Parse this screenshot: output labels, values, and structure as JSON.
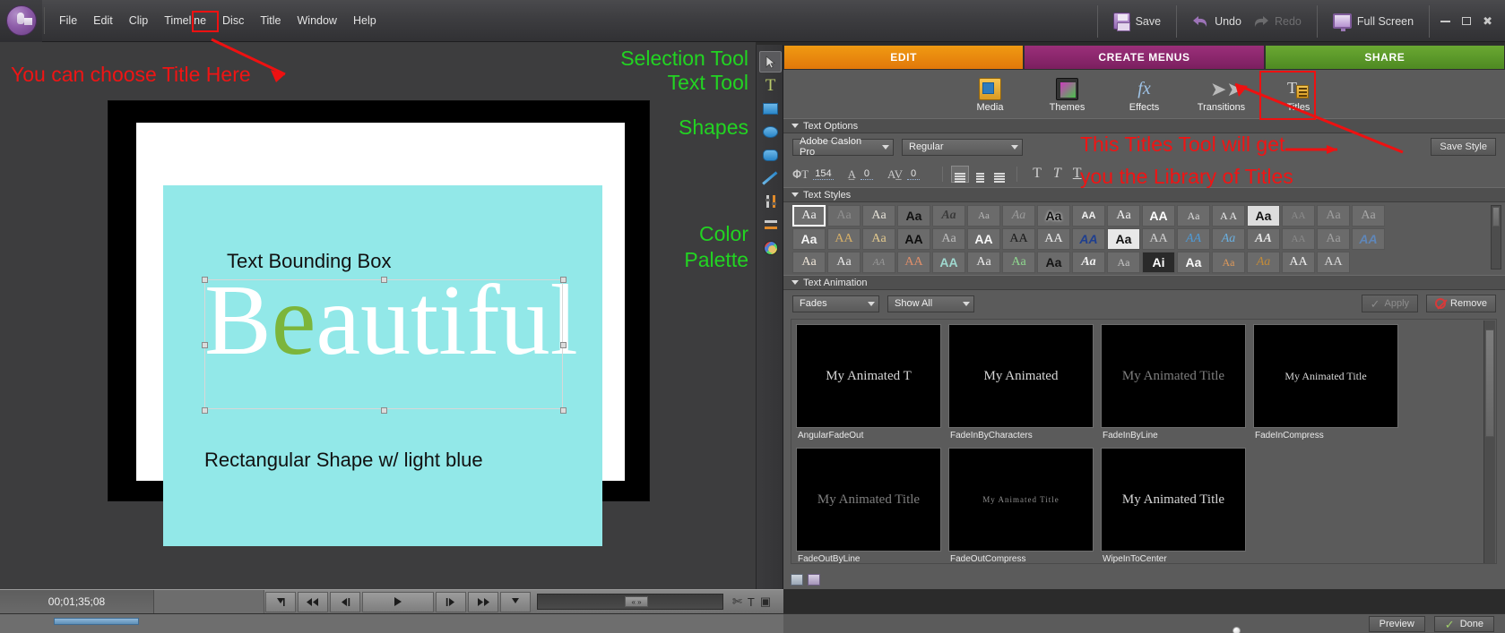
{
  "app": {
    "logo_icon": "adobe-premiere-elements-logo"
  },
  "menubar": {
    "items": [
      {
        "label": "File"
      },
      {
        "label": "Edit"
      },
      {
        "label": "Clip"
      },
      {
        "label": "Timeline"
      },
      {
        "label": "Disc"
      },
      {
        "label": "Title",
        "highlighted": true
      },
      {
        "label": "Window"
      },
      {
        "label": "Help"
      }
    ]
  },
  "topright": {
    "save_label": "Save",
    "save_icon": "floppy-disk-icon",
    "undo_label": "Undo",
    "undo_icon": "undo-arrow-icon",
    "redo_label": "Redo",
    "redo_icon": "redo-arrow-icon",
    "fullscreen_label": "Full Screen",
    "fullscreen_icon": "monitor-icon",
    "minimize_icon": "minimize-icon",
    "maximize_icon": "maximize-icon",
    "close_icon": "close-icon"
  },
  "annotations": [
    {
      "id": "title-here",
      "text": "You can choose Title Here",
      "color": "#f01414"
    },
    {
      "id": "selection-tool",
      "text": "Selection Tool",
      "color": "#22d422"
    },
    {
      "id": "text-tool",
      "text": "Text Tool",
      "color": "#22d422"
    },
    {
      "id": "shapes",
      "text": "Shapes",
      "color": "#22d422"
    },
    {
      "id": "color",
      "text": "Color",
      "color": "#22d422"
    },
    {
      "id": "palette",
      "text": "Palette",
      "color": "#22d422"
    },
    {
      "id": "titles-tool-1",
      "text": "This Titles Tool will get",
      "color": "#f01414"
    },
    {
      "id": "titles-tool-2",
      "text": "you the Library of Titles",
      "color": "#f01414"
    }
  ],
  "canvas": {
    "text_bounding_box_label": "Text Bounding Box",
    "title_text_part1": "B",
    "title_text_green": "e",
    "title_text_part2": "autiful",
    "rect_caption": "Rectangular Shape w/ light blue",
    "shape_color": "#92e8e8",
    "title_color": "#ffffff",
    "accent_letter_color": "#7cb53b"
  },
  "toolstrip": {
    "tools": [
      {
        "name": "selection-tool",
        "icon": "cursor-arrow-icon",
        "active": true
      },
      {
        "name": "text-tool",
        "icon": "text-T-icon",
        "active": false
      },
      {
        "name": "rectangle-tool",
        "icon": "rectangle-icon",
        "active": false
      },
      {
        "name": "ellipse-tool",
        "icon": "ellipse-icon",
        "active": false
      },
      {
        "name": "rounded-rect-tool",
        "icon": "rounded-rectangle-icon",
        "active": false
      },
      {
        "name": "line-tool",
        "icon": "line-icon",
        "active": false
      },
      {
        "name": "vertical-align-tool",
        "icon": "vertical-align-icon",
        "active": false
      },
      {
        "name": "horizontal-align-tool",
        "icon": "horizontal-align-icon",
        "active": false
      },
      {
        "name": "color-palette-tool",
        "icon": "palette-icon",
        "active": false
      }
    ]
  },
  "right_panel": {
    "mode_tabs": [
      {
        "label": "EDIT",
        "color": "#e9850e",
        "active": true
      },
      {
        "label": "CREATE MENUS",
        "color": "#8b2a6c",
        "active": false
      },
      {
        "label": "SHARE",
        "color": "#5c9a2a",
        "active": false
      }
    ],
    "tool_icons": [
      {
        "label": "Media",
        "icon": "media-icon",
        "highlighted": false
      },
      {
        "label": "Themes",
        "icon": "themes-icon",
        "highlighted": false
      },
      {
        "label": "Effects",
        "icon": "fx-icon",
        "highlighted": false
      },
      {
        "label": "Transitions",
        "icon": "transitions-arrow-icon",
        "highlighted": false
      },
      {
        "label": "Titles",
        "icon": "titles-icon",
        "highlighted": true
      }
    ],
    "text_options": {
      "section_title": "Text Options",
      "save_style_label": "Save Style",
      "font_family": "Adobe Caslon Pro",
      "font_style": "Regular",
      "font_size_icon": "font-size-icon",
      "font_size": "154",
      "leading_icon": "leading-icon",
      "leading": "0",
      "tracking_icon": "kerning-icon",
      "tracking": "0",
      "align_left_icon": "align-left-icon",
      "align_center_icon": "align-center-icon",
      "align_right_icon": "align-right-icon",
      "bold_label": "T",
      "italic_label": "T",
      "underline_label": "T"
    },
    "text_styles": {
      "section_title": "Text Styles",
      "swatches": [
        {
          "text": "Aa",
          "selected": true,
          "css": "font-family:'Liberation Serif',serif;color:#efefef;"
        },
        {
          "text": "Aa",
          "css": "font-family:'Liberation Serif',serif;color:#8f8f8f;"
        },
        {
          "text": "Aa",
          "css": "font-family:'Liberation Serif',serif;color:#e6e2d8;"
        },
        {
          "text": "Aa",
          "css": "font-family:'Liberation Sans',sans-serif;font-weight:bold;color:#111;"
        },
        {
          "text": "Aa",
          "css": "font-family:'Liberation Serif',serif;font-style:italic;font-weight:bold;color:#3a3a3a;"
        },
        {
          "text": "Aa",
          "css": "font-family:'Liberation Serif',serif;color:#b9b9b9;font-size:11px;"
        },
        {
          "text": "Aa",
          "css": "font-family:'Liberation Serif',serif;font-style:italic;color:#9a9a9a;"
        },
        {
          "text": "Aa",
          "css": "font-family:'Liberation Sans',sans-serif;font-weight:bold;color:#111;text-shadow:0 0 3px #fff;"
        },
        {
          "text": "AA",
          "css": "font-family:'Liberation Sans',sans-serif;font-weight:bold;font-size:11px;color:#f2f2f2;"
        },
        {
          "text": "Aa",
          "css": "font-family:'Liberation Serif',serif;color:#f4f4f4;"
        },
        {
          "text": "AA",
          "css": "font-family:'Liberation Sans',sans-serif;font-weight:bold;color:#fff;"
        },
        {
          "text": "Aa",
          "css": "font-family:'Liberation Serif',serif;color:#dcdcdc;font-size:12px;"
        },
        {
          "text": "A A",
          "css": "font-family:'Liberation Serif',serif;color:#ededed;font-size:12px;"
        },
        {
          "text": "Aa",
          "css": "font-family:'Liberation Sans',sans-serif;font-weight:bold;color:#111;background:#ddd;"
        },
        {
          "text": "AA",
          "css": "font-family:'Liberation Serif',serif;color:#8d8d8d;font-size:11px;"
        },
        {
          "text": "Aa",
          "css": "font-family:'Liberation Serif',serif;color:#9d9d9d;"
        },
        {
          "text": "Aa",
          "css": "font-family:'Liberation Serif',serif;color:#a8a8a8;"
        },
        {
          "text": "Aa",
          "css": "font-family:'Liberation Sans',sans-serif;font-weight:bold;color:#f5f5f5;"
        },
        {
          "text": "AA",
          "css": "font-family:'Liberation Serif',serif;color:#d8b168;"
        },
        {
          "text": "Aa",
          "css": "font-family:'Liberation Serif',serif;color:#e2c98e;"
        },
        {
          "text": "AA",
          "css": "font-family:'Liberation Sans',sans-serif;font-weight:bold;color:#0d0d0d;"
        },
        {
          "text": "Aa",
          "css": "font-family:'Liberation Serif',serif;color:#bdbdbd;"
        },
        {
          "text": "AA",
          "css": "font-family:'Liberation Sans',sans-serif;font-weight:bold;color:#f8f8f8;"
        },
        {
          "text": "AA",
          "css": "font-family:'Liberation Serif',serif;color:#1a1a1a;"
        },
        {
          "text": "AA",
          "css": "font-family:'Liberation Serif',serif;color:#efefef;"
        },
        {
          "text": "AA",
          "css": "font-family:'Liberation Sans',sans-serif;font-style:italic;font-weight:bold;color:#1f3f8f;"
        },
        {
          "text": "Aa",
          "css": "font-family:'Liberation Sans',sans-serif;font-weight:bold;color:#111;background:#e8e8e8;"
        },
        {
          "text": "AA",
          "css": "font-family:'Liberation Serif',serif;color:#d0d0d0;"
        },
        {
          "text": "AA",
          "css": "font-family:'Liberation Serif',serif;font-style:italic;color:#4f9ad6;"
        },
        {
          "text": "Aa",
          "css": "font-family:'Liberation Serif',serif;font-style:italic;color:#6aaede;"
        },
        {
          "text": "AA",
          "css": "font-family:'Liberation Serif',serif;font-style:italic;font-weight:bold;color:#e6e6e6;"
        },
        {
          "text": "AA",
          "css": "font-family:'Liberation Serif',serif;color:#8b8b8b;font-size:11px;"
        },
        {
          "text": "Aa",
          "css": "font-family:'Liberation Serif',serif;color:#a0a0a0;"
        },
        {
          "text": "AA",
          "css": "font-family:'Liberation Sans',sans-serif;font-style:italic;font-weight:bold;color:#5f86b8;"
        },
        {
          "text": "Aa",
          "css": "font-family:'Liberation Serif',serif;color:#efe6d8;"
        },
        {
          "text": "Aa",
          "css": "font-family:'Liberation Serif',serif;color:#e8e8e8;"
        },
        {
          "text": "AA",
          "css": "font-family:'Liberation Serif',serif;font-style:italic;color:#9a9a9a;font-size:11px;"
        },
        {
          "text": "AA",
          "css": "font-family:'Liberation Serif',serif;color:#e08f6a;"
        },
        {
          "text": "AA",
          "css": "font-family:'Liberation Sans',sans-serif;font-weight:bold;color:#9fd8cf;"
        },
        {
          "text": "Aa",
          "css": "font-family:'Liberation Serif',serif;color:#ececec;"
        },
        {
          "text": "Aa",
          "css": "font-family:'Liberation Serif',serif;color:#8fd88f;"
        },
        {
          "text": "Aa",
          "css": "font-family:'Liberation Sans',sans-serif;font-weight:bold;color:#151515;"
        },
        {
          "text": "Aa",
          "css": "font-family:'Liberation Serif',serif;font-style:italic;font-weight:bold;color:#f0f0f0;"
        },
        {
          "text": "Aa",
          "css": "font-family:'Liberation Serif',serif;color:#c6c6c6;font-size:12px;"
        },
        {
          "text": "Ai",
          "css": "font-family:'Liberation Sans',sans-serif;font-weight:bold;color:#fff;background:#2a2a2a;"
        },
        {
          "text": "Aa",
          "css": "font-family:'Liberation Sans',sans-serif;font-weight:bold;color:#fafafa;"
        },
        {
          "text": "Aa",
          "css": "font-family:'Liberation Serif',serif;color:#e09a5a;font-size:12px;"
        },
        {
          "text": "Aa",
          "css": "font-family:'Liberation Serif',serif;font-style:italic;color:#c08a3a;"
        },
        {
          "text": "AA",
          "css": "font-family:'Liberation Serif',serif;color:#efefef;"
        },
        {
          "text": "AA",
          "css": "font-family:'Liberation Serif',serif;color:#dadada;"
        }
      ]
    },
    "text_animation": {
      "section_title": "Text Animation",
      "category": "Fades",
      "filter": "Show All",
      "apply_label": "Apply",
      "apply_icon": "checkmark-icon",
      "apply_disabled": true,
      "remove_label": "Remove",
      "remove_icon": "no-entry-icon",
      "presets": [
        {
          "label": "AngularFadeOut",
          "preview_text": "My Animated T",
          "style": "normal"
        },
        {
          "label": "FadeInByCharacters",
          "preview_text": "My Animated",
          "style": "normal"
        },
        {
          "label": "FadeInByLine",
          "preview_text": "My Animated Title",
          "style": "faint"
        },
        {
          "label": "FadeInCompress",
          "preview_text": "My Animated Title",
          "style": "small"
        },
        {
          "label": "FadeOutByLine",
          "preview_text": "My Animated Title",
          "style": "faint"
        },
        {
          "label": "FadeOutCompress",
          "preview_text": "My Animated Title",
          "style": "tiny"
        },
        {
          "label": "WipeInToCenter",
          "preview_text": "My Animated Title",
          "style": "normal"
        }
      ]
    },
    "footer": {
      "icon_a": "new-item-icon",
      "icon_b": "save-preset-icon",
      "preview_label": "Preview",
      "done_label": "Done",
      "done_icon": "green-checkmark-icon"
    }
  },
  "playbar": {
    "timecode": "00;01;35;08",
    "buttons": [
      {
        "name": "set-in-point-button",
        "icon": "▼|"
      },
      {
        "name": "rewind-button",
        "icon": "◀◀"
      },
      {
        "name": "step-back-button",
        "icon": "◀|"
      },
      {
        "name": "play-button",
        "icon": "▶"
      },
      {
        "name": "step-forward-button",
        "icon": "|▶"
      },
      {
        "name": "fast-forward-button",
        "icon": "▶▶"
      },
      {
        "name": "set-out-point-button",
        "icon": "▼"
      }
    ],
    "zoom_knob_label": "«  »",
    "right_icons": [
      {
        "name": "scissors-icon",
        "glyph": "✄"
      },
      {
        "name": "text-tool-icon",
        "glyph": "T"
      },
      {
        "name": "camera-icon",
        "glyph": "▣"
      }
    ]
  }
}
